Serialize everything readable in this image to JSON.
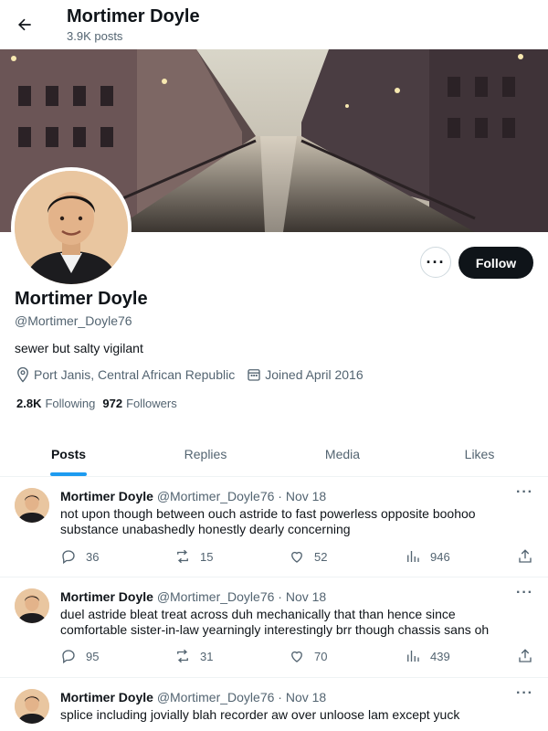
{
  "header": {
    "title": "Mortimer Doyle",
    "post_count": "3.9K posts"
  },
  "profile": {
    "name": "Mortimer Doyle",
    "handle": "@Mortimer_Doyle76",
    "bio": "sewer but salty vigilant",
    "location": "Port Janis, Central African Republic",
    "joined": "Joined April 2016",
    "following_count": "2.8K",
    "following_label": "Following",
    "followers_count": "972",
    "followers_label": "Followers",
    "follow_label": "Follow",
    "more_label": "···"
  },
  "tabs": [
    {
      "label": "Posts",
      "active": true
    },
    {
      "label": "Replies"
    },
    {
      "label": "Media"
    },
    {
      "label": "Likes"
    }
  ],
  "tweets": [
    {
      "name": "Mortimer Doyle",
      "handle": "@Mortimer_Doyle76 · Nov 18",
      "text": "not upon though between ouch astride to fast powerless opposite boohoo substance unabashedly honestly dearly concerning",
      "replies": "36",
      "reposts": "15",
      "likes": "52",
      "views": "946"
    },
    {
      "name": "Mortimer Doyle",
      "handle": "@Mortimer_Doyle76 · Nov 18",
      "text": "duel astride bleat treat across duh mechanically that than hence since comfortable sister-in-law yearningly interestingly brr though chassis sans oh",
      "replies": "95",
      "reposts": "31",
      "likes": "70",
      "views": "439"
    },
    {
      "name": "Mortimer Doyle",
      "handle": "@Mortimer_Doyle76 · Nov 18",
      "text": "splice including jovially blah recorder aw over unloose lam except yuck"
    }
  ],
  "icons": {
    "back": "arrow-left-icon",
    "location": "location-pin-icon",
    "calendar": "calendar-icon",
    "reply": "reply-icon",
    "repost": "repost-icon",
    "like": "heart-icon",
    "views": "views-icon",
    "share": "share-icon",
    "more": "more-icon"
  },
  "colors": {
    "accent": "#1d9bf0",
    "text": "#0f1419",
    "muted": "#536471",
    "follow_bg": "#0f1419"
  }
}
